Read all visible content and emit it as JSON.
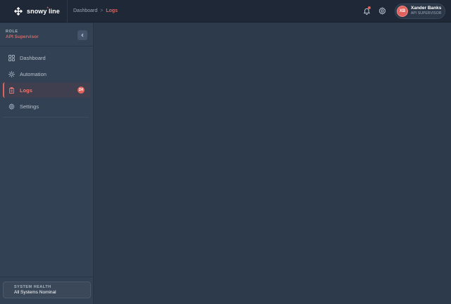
{
  "app": {
    "brand_prefix": "snowy",
    "brand_mark": "*",
    "brand_suffix": "line"
  },
  "breadcrumb": {
    "parent": "Dashboard",
    "separator": ">",
    "current": "Logs"
  },
  "header": {
    "notifications_icon": "bell-icon",
    "settings_icon": "gear-icon"
  },
  "user": {
    "initials": "XB",
    "name": "Xander Banks",
    "role": "API SUPERVISOR"
  },
  "sidebar": {
    "role_label": "ROLE",
    "role_value": "API Supervisor",
    "items": [
      {
        "label": "Dashboard",
        "icon": "grid-icon"
      },
      {
        "label": "Automation",
        "icon": "sun-icon"
      },
      {
        "label": "Logs",
        "icon": "clipboard-icon",
        "badge": "24",
        "active": true
      },
      {
        "label": "Settings",
        "icon": "gear-icon"
      }
    ],
    "health_label": "SYSTEM HEALTH",
    "health_value": "All Systems Nominal"
  },
  "colors": {
    "accent": "#e0625d",
    "topbar": "#1e2836",
    "sidebar": "#324153",
    "main": "#2c3a4b"
  }
}
